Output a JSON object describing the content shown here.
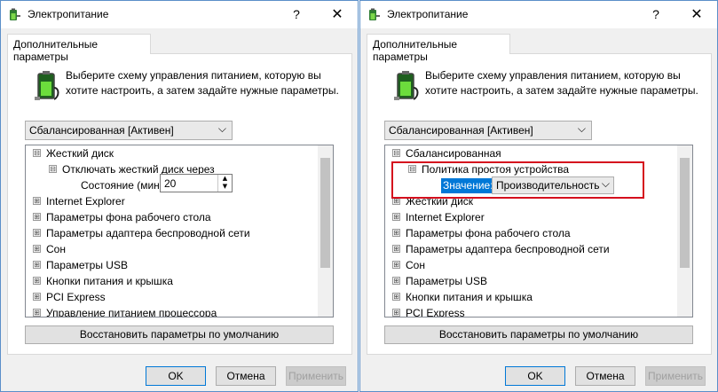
{
  "left": {
    "title": "Электропитание",
    "help": "?",
    "close": "✕",
    "tab": "Дополнительные параметры",
    "description": "Выберите схему управления питанием, которую вы хотите настроить, а затем задайте нужные параметры.",
    "scheme": "Сбалансированная [Активен]",
    "tree": {
      "n0": {
        "toggle": "⊟",
        "label": "Жесткий диск"
      },
      "n1": {
        "toggle": "⊟",
        "label": "Отключать жесткий диск через"
      },
      "setting_label": "Состояние (мин.):",
      "setting_value": "20",
      "n2": {
        "toggle": "⊞",
        "label": "Internet Explorer"
      },
      "n3": {
        "toggle": "⊞",
        "label": "Параметры фона рабочего стола"
      },
      "n4": {
        "toggle": "⊞",
        "label": "Параметры адаптера беспроводной сети"
      },
      "n5": {
        "toggle": "⊞",
        "label": "Сон"
      },
      "n6": {
        "toggle": "⊞",
        "label": "Параметры USB"
      },
      "n7": {
        "toggle": "⊞",
        "label": "Кнопки питания и крышка"
      },
      "n8": {
        "toggle": "⊞",
        "label": "PCI Express"
      },
      "n9": {
        "toggle": "⊞",
        "label": "Управление питанием процессора"
      }
    },
    "restore": "Восстановить параметры по умолчанию",
    "ok": "OK",
    "cancel": "Отмена",
    "apply": "Применить"
  },
  "right": {
    "title": "Электропитание",
    "help": "?",
    "close": "✕",
    "tab": "Дополнительные параметры",
    "description": "Выберите схему управления питанием, которую вы хотите настроить, а затем задайте нужные параметры.",
    "scheme": "Сбалансированная [Активен]",
    "tree": {
      "n0": {
        "toggle": "⊟",
        "label": "Сбалансированная"
      },
      "n1": {
        "toggle": "⊟",
        "label": "Политика простоя устройства"
      },
      "setting_label": "Значение:",
      "setting_value": "Производительность",
      "n2": {
        "toggle": "⊞",
        "label": "Жесткий диск"
      },
      "n3": {
        "toggle": "⊞",
        "label": "Internet Explorer"
      },
      "n4": {
        "toggle": "⊞",
        "label": "Параметры фона рабочего стола"
      },
      "n5": {
        "toggle": "⊞",
        "label": "Параметры адаптера беспроводной сети"
      },
      "n6": {
        "toggle": "⊞",
        "label": "Сон"
      },
      "n7": {
        "toggle": "⊞",
        "label": "Параметры USB"
      },
      "n8": {
        "toggle": "⊞",
        "label": "Кнопки питания и крышка"
      },
      "n9": {
        "toggle": "⊞",
        "label": "PCI Express"
      }
    },
    "restore": "Восстановить параметры по умолчанию",
    "ok": "OK",
    "cancel": "Отмена",
    "apply": "Применить"
  },
  "colors": {
    "selection": "#0078d7",
    "highlight_box": "#d50f1d",
    "window_border": "#5b8fc9"
  },
  "icons": [
    "power-options-icon",
    "battery-plug-icon",
    "help-icon",
    "close-icon",
    "chevron-down-icon",
    "spin-up-icon",
    "spin-down-icon",
    "collapse-icon",
    "expand-icon"
  ]
}
